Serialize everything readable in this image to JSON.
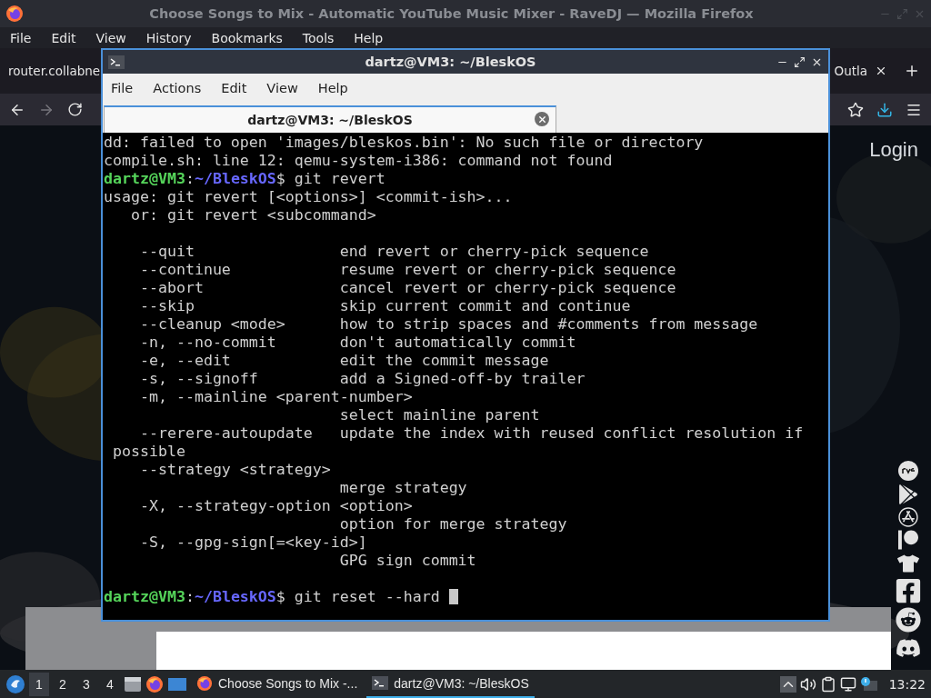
{
  "browser": {
    "title": "Choose Songs to Mix - Automatic YouTube Music Mixer - RaveDJ — Mozilla Firefox",
    "menu": [
      "File",
      "Edit",
      "View",
      "History",
      "Bookmarks",
      "Tools",
      "Help"
    ],
    "tabs": [
      {
        "label": "router.collabne",
        "selected": false
      },
      {
        "label": "Outla",
        "selected": false
      }
    ],
    "page": {
      "login": "Login"
    }
  },
  "terminal": {
    "title": "dartz@VM3: ~/BleskOS",
    "menu": [
      "File",
      "Actions",
      "Edit",
      "View",
      "Help"
    ],
    "tabs": [
      {
        "label": "dartz@VM3: ~/BleskOS",
        "selected": true
      }
    ],
    "lines": [
      {
        "kind": "output",
        "text": "dd: failed to open 'images/bleskos.bin': No such file or directory"
      },
      {
        "kind": "output",
        "text": "compile.sh: line 12: qemu-system-i386: command not found"
      },
      {
        "kind": "prompt",
        "user": "dartz@VM3",
        "sep": ":",
        "path": "~/BleskOS",
        "command": "$ git revert",
        "cursor": false
      },
      {
        "kind": "output",
        "text": "usage: git revert [<options>] <commit-ish>..."
      },
      {
        "kind": "output",
        "text": "   or: git revert <subcommand>"
      },
      {
        "kind": "blank"
      },
      {
        "kind": "output",
        "text": "    --quit                end revert or cherry-pick sequence"
      },
      {
        "kind": "output",
        "text": "    --continue            resume revert or cherry-pick sequence"
      },
      {
        "kind": "output",
        "text": "    --abort               cancel revert or cherry-pick sequence"
      },
      {
        "kind": "output",
        "text": "    --skip                skip current commit and continue"
      },
      {
        "kind": "output",
        "text": "    --cleanup <mode>      how to strip spaces and #comments from message"
      },
      {
        "kind": "output",
        "text": "    -n, --no-commit       don't automatically commit"
      },
      {
        "kind": "output",
        "text": "    -e, --edit            edit the commit message"
      },
      {
        "kind": "output",
        "text": "    -s, --signoff         add a Signed-off-by trailer"
      },
      {
        "kind": "output",
        "text": "    -m, --mainline <parent-number>"
      },
      {
        "kind": "output",
        "text": "                          select mainline parent"
      },
      {
        "kind": "output",
        "text": "    --rerere-autoupdate   update the index with reused conflict resolution if"
      },
      {
        "kind": "output",
        "text": " possible"
      },
      {
        "kind": "output",
        "text": "    --strategy <strategy>"
      },
      {
        "kind": "output",
        "text": "                          merge strategy"
      },
      {
        "kind": "output",
        "text": "    -X, --strategy-option <option>"
      },
      {
        "kind": "output",
        "text": "                          option for merge strategy"
      },
      {
        "kind": "output",
        "text": "    -S, --gpg-sign[=<key-id>]"
      },
      {
        "kind": "output",
        "text": "                          GPG sign commit"
      },
      {
        "kind": "blank"
      },
      {
        "kind": "prompt",
        "user": "dartz@VM3",
        "sep": ":",
        "path": "~/BleskOS",
        "command": "$ git reset --hard ",
        "cursor": true
      }
    ]
  },
  "taskbar": {
    "workspaces": [
      {
        "label": "1",
        "selected": true
      },
      {
        "label": "2",
        "selected": false
      },
      {
        "label": "3",
        "selected": false
      },
      {
        "label": "4",
        "selected": false
      }
    ],
    "tasks": [
      {
        "kind": "browser",
        "label": "Choose Songs to Mix -...",
        "selected": false
      },
      {
        "kind": "terminal",
        "label": "dartz@VM3: ~/BleskOS",
        "selected": true
      }
    ],
    "clock": "13:22"
  }
}
